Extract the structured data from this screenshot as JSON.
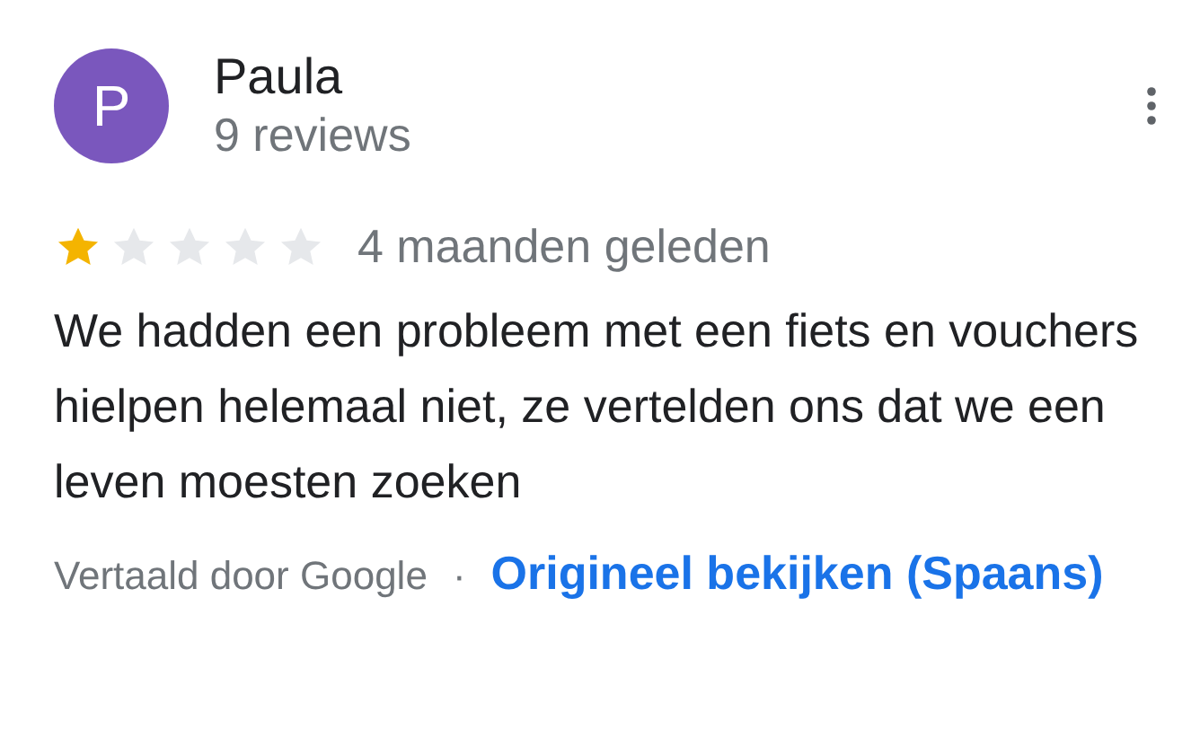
{
  "reviewer": {
    "initial": "P",
    "color": "#7a57bd",
    "name": "Paula",
    "reviews": "9 reviews"
  },
  "rating": {
    "stars": 1
  },
  "time": "4 maanden geleden",
  "text": "We hadden een probleem met een fiets en vouchers hielpen helemaal niet, ze vertelden ons dat we een leven moesten zoeken",
  "translation": {
    "note": "Vertaald door Google",
    "separator": "·",
    "link": "Origineel bekijken (Spaans)"
  }
}
